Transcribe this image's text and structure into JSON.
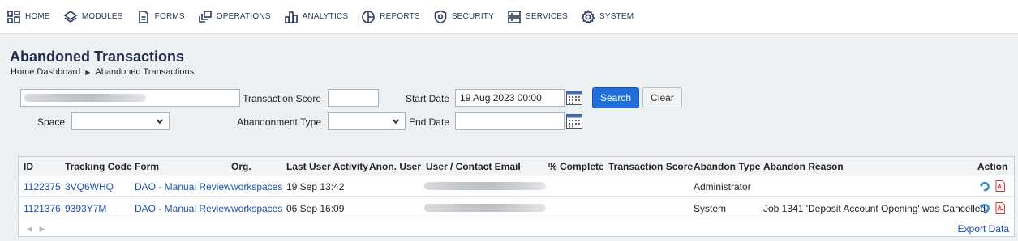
{
  "nav": {
    "items": [
      {
        "label": "HOME",
        "icon": "home-grid-icon"
      },
      {
        "label": "MODULES",
        "icon": "modules-icon"
      },
      {
        "label": "FORMS",
        "icon": "form-document-icon"
      },
      {
        "label": "OPERATIONS",
        "icon": "operations-icon"
      },
      {
        "label": "ANALYTICS",
        "icon": "bar-chart-icon"
      },
      {
        "label": "REPORTS",
        "icon": "pie-chart-icon"
      },
      {
        "label": "SECURITY",
        "icon": "shield-icon"
      },
      {
        "label": "SERVICES",
        "icon": "server-icon"
      },
      {
        "label": "SYSTEM",
        "icon": "gear-icon"
      }
    ]
  },
  "page": {
    "title": "Abandoned Transactions",
    "breadcrumb": [
      "Home Dashboard",
      "Abandoned Transactions"
    ]
  },
  "filters": {
    "search_value": "",
    "space_label": "Space",
    "space_value": "",
    "transaction_score_label": "Transaction Score",
    "transaction_score_value": "",
    "abandonment_type_label": "Abandonment Type",
    "abandonment_type_value": "",
    "start_date_label": "Start Date",
    "start_date_value": "19 Aug 2023 00:00",
    "end_date_label": "End Date",
    "end_date_value": "",
    "search_button": "Search",
    "clear_button": "Clear"
  },
  "table": {
    "columns": [
      "ID",
      "Tracking Code",
      "Form",
      "Org.",
      "Last User Activity",
      "Anon. User",
      "User / Contact Email",
      "% Complete",
      "Transaction Score",
      "Abandon Type",
      "Abandon Reason",
      "Action"
    ],
    "rows": [
      {
        "id": "1122375",
        "tracking_code": "3VQ6WHQ",
        "form": "DAO - Manual Review",
        "org": "workspaces",
        "last_activity": "19 Sep 13:42",
        "anon_user": "",
        "email": "",
        "pct_complete": "",
        "transaction_score": "",
        "abandon_type": "Administrator",
        "abandon_reason": ""
      },
      {
        "id": "1121376",
        "tracking_code": "9393Y7M",
        "form": "DAO - Manual Review",
        "org": "workspaces",
        "last_activity": "06 Sep 16:09",
        "anon_user": "",
        "email": "",
        "pct_complete": "",
        "transaction_score": "",
        "abandon_type": "System",
        "abandon_reason": "Job 1341 'Deposit Account Opening' was Cancelled."
      }
    ],
    "export_label": "Export Data"
  },
  "colors": {
    "accent": "#1f6fd6",
    "link": "#1a4fb8",
    "title": "#1e2b4d",
    "pdf_red": "#d9342b",
    "restore_blue": "#2f86d1"
  }
}
